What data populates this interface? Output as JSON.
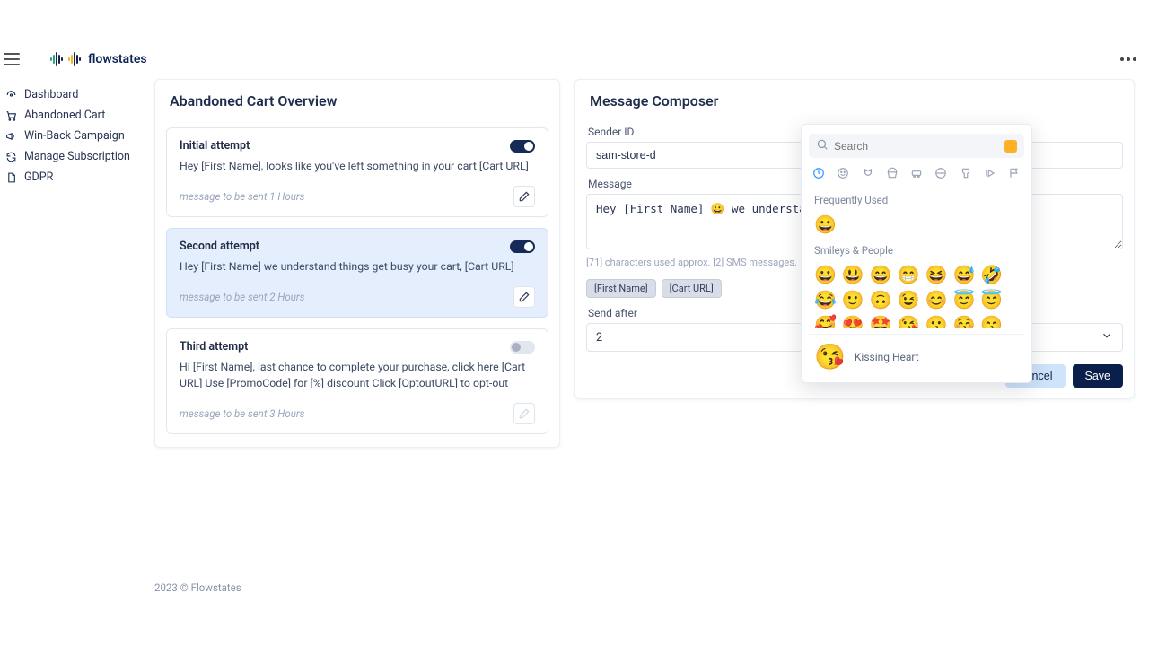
{
  "brand": {
    "name": "flowstates"
  },
  "nav": {
    "items": [
      {
        "label": "Dashboard"
      },
      {
        "label": "Abandoned Cart"
      },
      {
        "label": "Win-Back Campaign"
      },
      {
        "label": "Manage Subscription"
      },
      {
        "label": "GDPR"
      }
    ]
  },
  "overview": {
    "title": "Abandoned Cart Overview",
    "attempts": [
      {
        "title": "Initial attempt",
        "body": "Hey [First Name], looks like you've left something in your cart [Cart URL]",
        "sendNote": "message to be sent 1 Hours",
        "enabled": true,
        "active": false
      },
      {
        "title": "Second attempt",
        "body": "Hey [First Name] we understand things get busy your cart, [Cart URL]",
        "sendNote": "message to be sent 2 Hours",
        "enabled": true,
        "active": true
      },
      {
        "title": "Third attempt",
        "body": "Hi [First Name], last chance to complete your purchase, click here [Cart URL] Use [PromoCode] for [%] discount Click [OptoutURL] to opt-out",
        "sendNote": "message to be sent 3 Hours",
        "enabled": false,
        "active": false
      }
    ]
  },
  "composer": {
    "title": "Message Composer",
    "senderLabel": "Sender ID",
    "senderValue": "sam-store-d",
    "messageLabel": "Message",
    "messageValue": "Hey [First Name] 😀 we understand things get bu",
    "charInfo": "[71] characters used approx. [2] SMS messages.",
    "tags": [
      "[First Name]",
      "[Cart URL]"
    ],
    "sendAfterLabel": "Send after",
    "sendAfterValue": "2",
    "cancel": "Cancel",
    "save": "Save"
  },
  "emoji": {
    "searchPlaceholder": "Search",
    "sectionFreq": "Frequently Used",
    "sectionSmileys": "Smileys & People",
    "previewName": "Kissing Heart",
    "previewGlyph": "😘",
    "freq": "😀",
    "row1": "😀😃😄😁😆😅🤣",
    "row2": "😂🙂🙃😉😊😇😇",
    "row3": "🥰😍🤩😘😗😚😙"
  },
  "footer": "2023 © Flowstates"
}
